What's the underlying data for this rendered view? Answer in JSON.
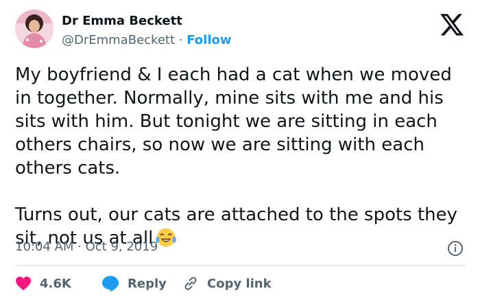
{
  "author": {
    "name": "Dr Emma Beckett",
    "handle": "@DrEmmaBeckett",
    "separator": "·",
    "follow_label": "Follow"
  },
  "tweet": {
    "paragraph1": "My boyfriend & I each had a cat when we moved in together. Normally, mine sits with me and his sits with him. But tonight we are sitting in each others chairs, so now we are sitting with each others cats.",
    "paragraph2": "Turns out, our cats are attached to the spots they sit, not us at all",
    "emoji": "face-with-tears-of-joy",
    "timestamp": "10:04 AM · Oct 9, 2019"
  },
  "actions": {
    "like_count": "4.6K",
    "reply_label": "Reply",
    "copy_label": "Copy link"
  },
  "colors": {
    "accent": "#1d9bf0",
    "heart": "#f91880",
    "muted_text": "#536471",
    "divider": "#cfd9de"
  },
  "icons": [
    "x-logo-icon",
    "info-icon",
    "heart-icon",
    "reply-bubble-icon",
    "link-icon"
  ]
}
